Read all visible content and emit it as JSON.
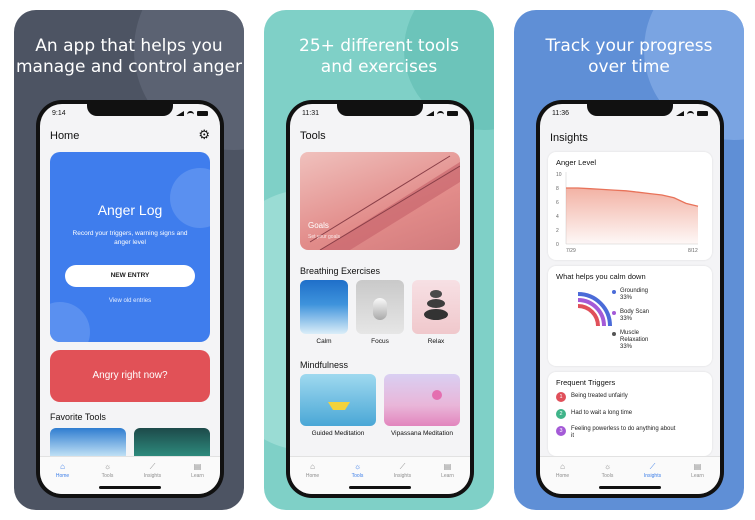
{
  "panels": [
    {
      "headline_line1": "An app that helps you",
      "headline_line2": "manage and control anger",
      "time": "9:14"
    },
    {
      "headline_line1": "25+ different tools",
      "headline_line2": "and exercises",
      "time": "11:31"
    },
    {
      "headline_line1": "Track your progress",
      "headline_line2": "over time",
      "time": "11:36"
    }
  ],
  "home": {
    "title": "Home",
    "anger_log": {
      "title": "Anger Log",
      "subtitle": "Record your triggers, warning signs and anger level",
      "button": "NEW ENTRY",
      "link": "View old entries"
    },
    "angry_now": "Angry right now?",
    "favorite_tools": "Favorite Tools"
  },
  "tools": {
    "title": "Tools",
    "goals": {
      "label": "Goals",
      "sub": "Set your goals"
    },
    "breathing_title": "Breathing Exercises",
    "breathing": [
      "Calm",
      "Focus",
      "Relax"
    ],
    "mindfulness_title": "Mindfulness",
    "mindfulness": [
      "Guided Meditation",
      "Vipassana Meditation"
    ]
  },
  "insights": {
    "title": "Insights",
    "anger_level": {
      "title": "Anger Level"
    },
    "calm": {
      "title": "What helps you calm down",
      "items": [
        {
          "name": "Grounding",
          "pct": "33%",
          "color": "#4b6bd8"
        },
        {
          "name": "Body Scan",
          "pct": "33%",
          "color": "#a45ad7"
        },
        {
          "name": "Muscle",
          "name2": "Relaxation",
          "pct": "33%",
          "color": "#e0505a"
        }
      ]
    },
    "triggers": {
      "title": "Frequent Triggers",
      "items": [
        {
          "n": "1",
          "text": "Being treated unfairly",
          "color": "#e0505a"
        },
        {
          "n": "2",
          "text": "Had to wait a long time",
          "color": "#3fb489"
        },
        {
          "n": "3",
          "text": "Feeling powerless to do anything about it",
          "color": "#a45ad7"
        }
      ]
    }
  },
  "tabs": [
    "Home",
    "Tools",
    "Insights",
    "Learn"
  ],
  "chart_data": {
    "type": "area",
    "title": "Anger Level",
    "x": [
      "7/29",
      "",
      "",
      "",
      "",
      "",
      "",
      "",
      "",
      "",
      "",
      "8/12"
    ],
    "series": [
      {
        "values": [
          8,
          8,
          7.9,
          7.8,
          7.7,
          7.6,
          7.4,
          7.2,
          7.0,
          6.6,
          5.8,
          5.4
        ]
      }
    ],
    "yticks": [
      0,
      2,
      4,
      6,
      8,
      10
    ],
    "xticks": [
      "7/29",
      "8/12"
    ],
    "ylim": [
      0,
      10
    ],
    "color": "#e8735a"
  }
}
